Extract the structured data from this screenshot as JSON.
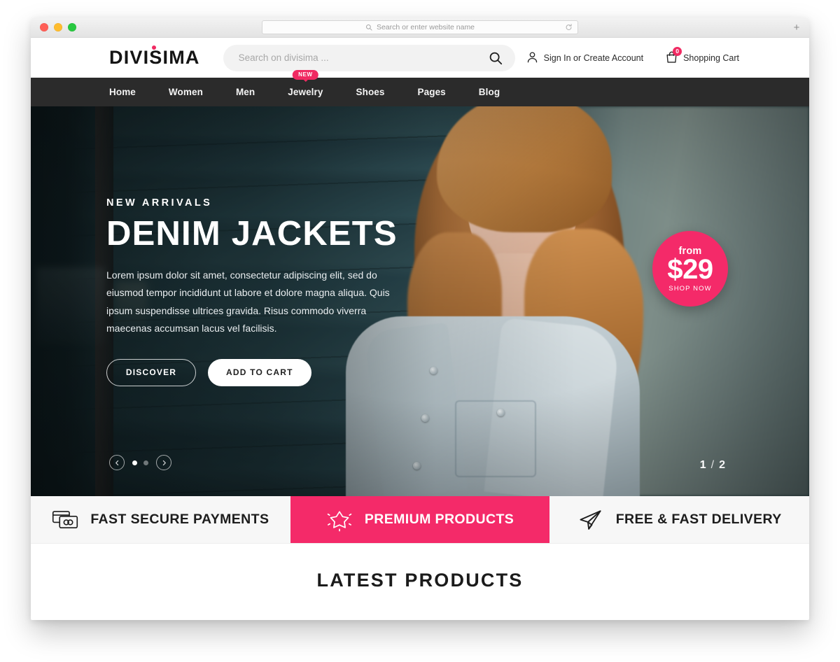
{
  "browser": {
    "omnibox_placeholder": "Search or enter website name",
    "reload_icon": "reload-icon",
    "new_tab_label": "+",
    "traffic_lights": [
      "close",
      "minimize",
      "zoom"
    ]
  },
  "header": {
    "brand": "DIVISIMA",
    "search": {
      "placeholder": "Search on divisima ...",
      "value": "",
      "icon": "search-icon"
    },
    "account": {
      "label": "Sign In or Create Account",
      "icon": "user-icon"
    },
    "cart": {
      "label": "Shopping Cart",
      "icon": "shopping-bag-icon",
      "count": "0"
    }
  },
  "nav": {
    "items": [
      {
        "label": "Home",
        "badge": null
      },
      {
        "label": "Women",
        "badge": null
      },
      {
        "label": "Men",
        "badge": null
      },
      {
        "label": "Jewelry",
        "badge": "NEW"
      },
      {
        "label": "Shoes",
        "badge": null
      },
      {
        "label": "Pages",
        "badge": null
      },
      {
        "label": "Blog",
        "badge": null
      }
    ]
  },
  "hero": {
    "eyebrow": "NEW ARRIVALS",
    "title": "DENIM JACKETS",
    "body": "Lorem ipsum dolor sit amet, consectetur adipiscing elit, sed do eiusmod tempor incididunt ut labore et dolore magna aliqua. Quis ipsum suspendisse ultrices gravida. Risus commodo viverra maecenas accumsan lacus vel facilisis.",
    "primary_button": "DISCOVER",
    "secondary_button": "ADD TO CART",
    "price_badge": {
      "prefix": "from",
      "amount": "$29",
      "cta": "SHOP NOW",
      "color": "#f42a69"
    },
    "carousel": {
      "prev_icon": "chevron-left-icon",
      "next_icon": "chevron-right-icon",
      "current": "1",
      "separator": "/",
      "total": "2",
      "dots": 2,
      "active_dot": 0
    }
  },
  "features": [
    {
      "label": "FAST SECURE PAYMENTS",
      "icon": "credit-cards-icon",
      "highlight": false
    },
    {
      "label": "PREMIUM PRODUCTS",
      "icon": "star-sparkle-icon",
      "highlight": true
    },
    {
      "label": "FREE & FAST DELIVERY",
      "icon": "paper-plane-icon",
      "highlight": false
    }
  ],
  "latest": {
    "title": "LATEST PRODUCTS"
  },
  "colors": {
    "accent": "#f42a69",
    "nav_bg": "#2b2b2b",
    "feature_bg": "#f7f7f7",
    "text_dark": "#1d1d1d"
  }
}
